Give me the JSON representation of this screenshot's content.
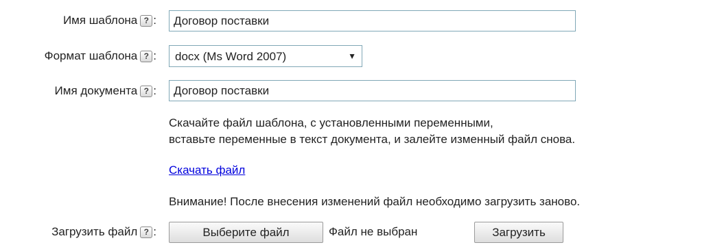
{
  "form": {
    "template_name": {
      "label": "Имя шаблона",
      "value": "Договор поставки"
    },
    "template_format": {
      "label": "Формат шаблона",
      "selected": "docx (Ms Word 2007)"
    },
    "document_name": {
      "label": "Имя документа",
      "value": "Договор поставки"
    },
    "instructions": {
      "line1": "Скачайте файл шаблона, с установленными переменными,",
      "line2": "вставьте переменные в текст документа, и залейте изменный файл снова."
    },
    "download_link": "Скачать файл",
    "warning": "Внимание! После внесения изменений файл необходимо загрузить заново.",
    "upload": {
      "label": "Загрузить файл",
      "choose_button": "Выберите файл",
      "file_status": "Файл не выбран",
      "upload_button": "Загрузить"
    }
  },
  "help_icon_glyph": "?",
  "colon": ":",
  "colors": {
    "input_border": "#7fa7b6",
    "link": "#0000dd",
    "text": "#222222"
  }
}
